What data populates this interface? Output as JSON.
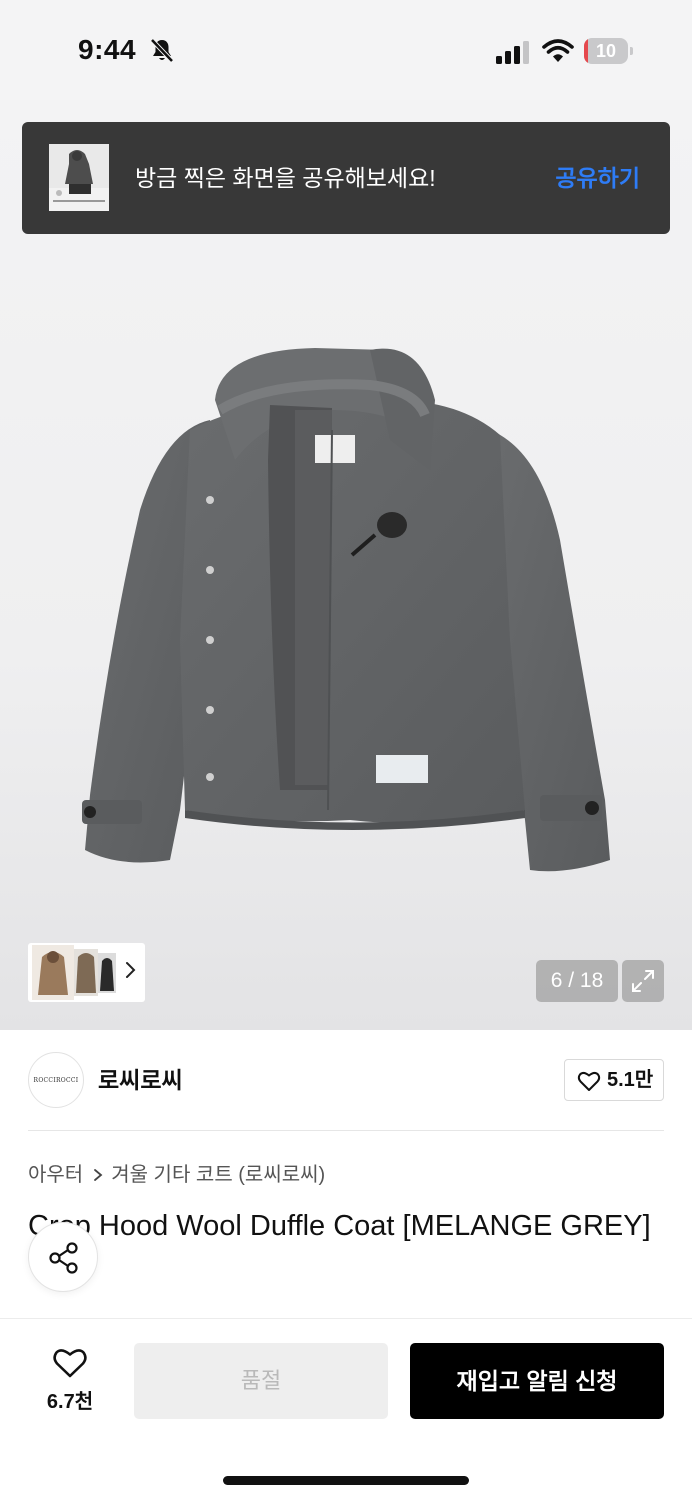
{
  "status_bar": {
    "time": "9:44",
    "battery_level": "10",
    "battery_fraction": 0.1,
    "battery_color": "#e5484d"
  },
  "share_banner": {
    "message": "방금 찍은 화면을 공유해보세요!",
    "action_label": "공유하기",
    "action_color": "#2e7cf6"
  },
  "gallery": {
    "counter": "6 / 18",
    "current_index": 6,
    "total": 18
  },
  "brand": {
    "name": "로씨로씨",
    "logo_text": "ROCCIROCCI",
    "like_count": "5.1만"
  },
  "breadcrumb": {
    "category": "아우터",
    "subcategory": "겨울 기타 코트 (로씨로씨)"
  },
  "product": {
    "title": "Crop Hood Wool Duffle Coat [MELANGE GREY]"
  },
  "bottom_bar": {
    "wish_count": "6.7천",
    "soldout_label": "품절",
    "restock_label": "재입고 알림 신청"
  },
  "icons": [
    "bell-slash-icon",
    "signal-icon",
    "wifi-icon",
    "heart-icon",
    "share-icon",
    "expand-icon",
    "chevron-right-icon"
  ]
}
